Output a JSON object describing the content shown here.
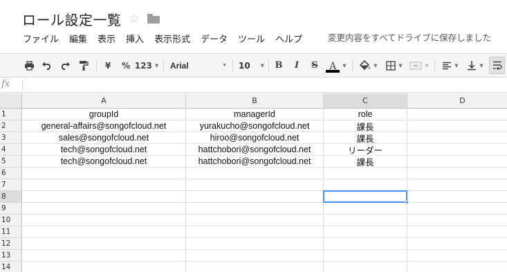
{
  "document": {
    "title": "ロール設定一覧",
    "star_icon": "star-outline-icon",
    "folder_icon": "folder-icon"
  },
  "menu": {
    "items": [
      "ファイル",
      "編集",
      "表示",
      "挿入",
      "表示形式",
      "データ",
      "ツール",
      "ヘルプ"
    ],
    "save_status": "変更内容をすべてドライブに保存しました"
  },
  "toolbar": {
    "currency_label": "¥",
    "percent_label": "%",
    "more_formats_label": "123",
    "font_name": "Arial",
    "font_size": "10",
    "bold_label": "B",
    "italic_label": "I",
    "strikethrough_label": "S",
    "text_color_label": "A",
    "text_color": "#000000",
    "icons": [
      "print-icon",
      "undo-icon",
      "redo-icon",
      "paint-format-icon",
      "fill-color-icon",
      "borders-icon",
      "merge-cells-icon",
      "align-left-icon",
      "valign-bottom-icon",
      "text-wrap-icon"
    ]
  },
  "formula_bar": {
    "fx_label": "fx",
    "value": ""
  },
  "sheet": {
    "columns": [
      "A",
      "B",
      "C",
      "D"
    ],
    "rows": [
      "1",
      "2",
      "3",
      "4",
      "5",
      "6",
      "7",
      "8",
      "9",
      "10",
      "11",
      "12",
      "13",
      "14"
    ],
    "cells": [
      [
        "groupId",
        "managerId",
        "role",
        ""
      ],
      [
        "general-affairs@songofcloud.net",
        "yurakucho@songofcloud.net",
        "課長",
        ""
      ],
      [
        "sales@songofcloud.net",
        "hiroo@songofcloud.net",
        "課長",
        ""
      ],
      [
        "tech@songofcloud.net",
        "hattchobori@songofcloud.net",
        "リーダー",
        ""
      ],
      [
        "tech@songofcloud.net",
        "hattchobori@songofcloud.net",
        "課長",
        ""
      ],
      [
        "",
        "",
        "",
        ""
      ],
      [
        "",
        "",
        "",
        ""
      ],
      [
        "",
        "",
        "",
        ""
      ],
      [
        "",
        "",
        "",
        ""
      ],
      [
        "",
        "",
        "",
        ""
      ],
      [
        "",
        "",
        "",
        ""
      ],
      [
        "",
        "",
        "",
        ""
      ],
      [
        "",
        "",
        "",
        ""
      ],
      [
        "",
        "",
        "",
        ""
      ]
    ],
    "selected_cell": "C8",
    "accent_color": "#4d90fe"
  }
}
